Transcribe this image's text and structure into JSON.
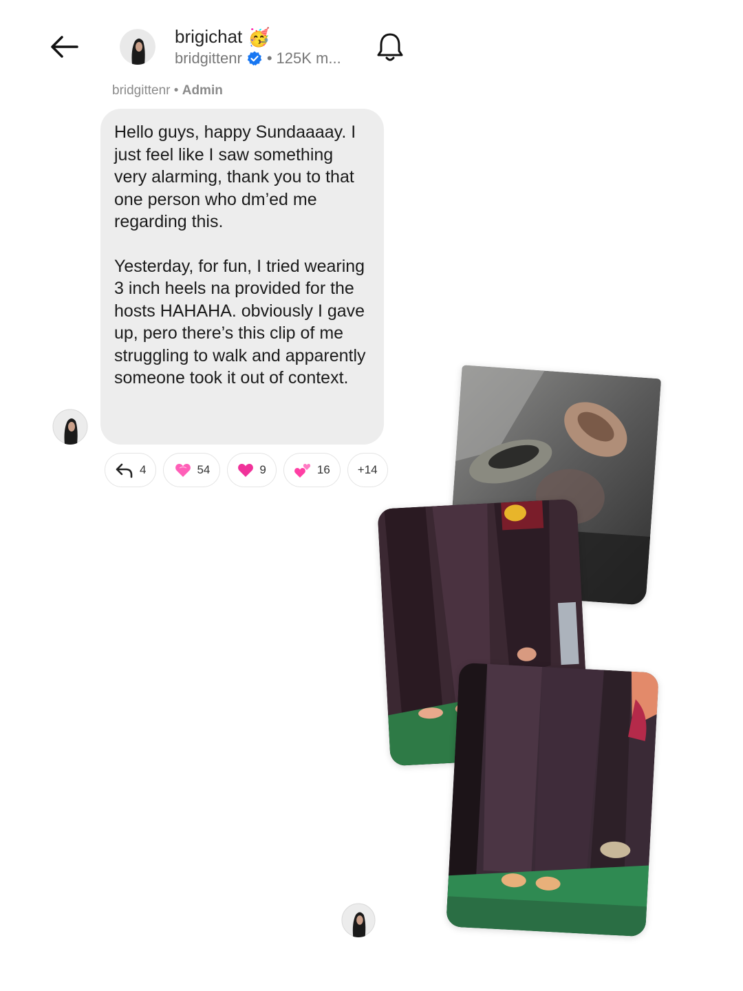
{
  "header": {
    "title": "brigichat",
    "title_emoji": "🥳",
    "handle": "bridgittenr",
    "members": "125K m..."
  },
  "sender": {
    "name": "bridgittenr",
    "role": "Admin"
  },
  "message": {
    "paragraph1": "Hello guys, happy Sundaaaay. I just feel like I saw something very alarming, thank you to that one person who dm’ed me regarding this.",
    "paragraph2": "Yesterday, for fun, I tried wearing 3 inch heels na provided for the hosts HAHAHA. obviously I gave up, pero there’s this clip of me struggling to walk and apparently someone took it out of context."
  },
  "reactions": {
    "replies": "4",
    "pink_heart": "54",
    "heart": "9",
    "two_hearts": "16",
    "more": "+14"
  },
  "colors": {
    "pink": "#ff3fa4",
    "verified_blue": "#1877f2",
    "bubble": "#ededed"
  },
  "icons": [
    "back-arrow-icon",
    "verified-icon",
    "bell-icon",
    "reply-icon",
    "pink-heart-icon",
    "heart-icon",
    "two-hearts-icon"
  ]
}
